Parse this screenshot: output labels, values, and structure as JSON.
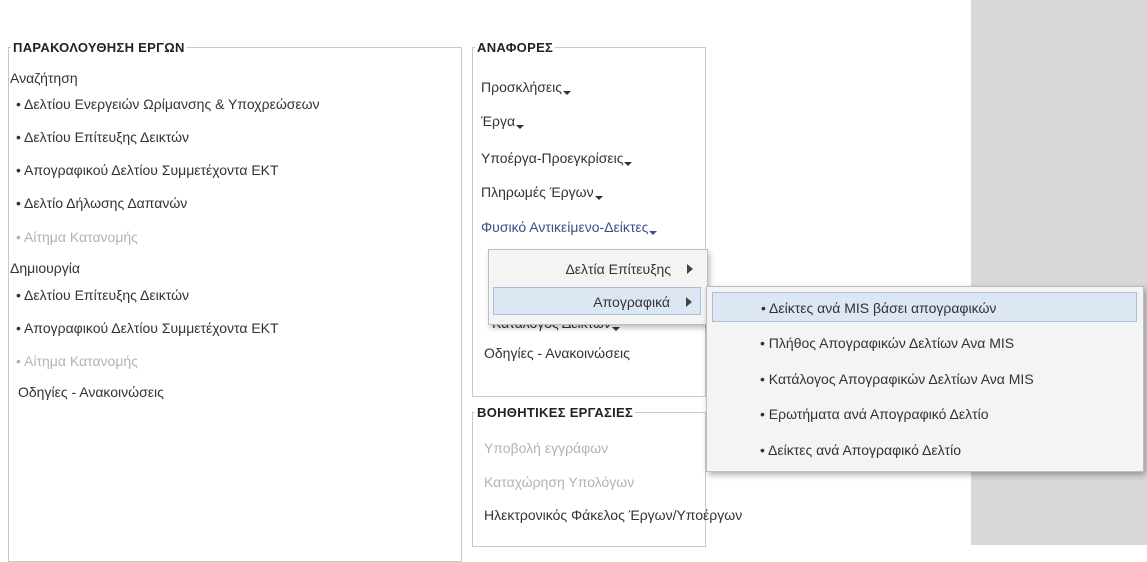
{
  "projects": {
    "legend": "ΠΑΡΑΚΟΛΟΥΘΗΣΗ ΕΡΓΩΝ",
    "search_heading": "Αναζήτηση",
    "search_items": [
      "Δελτίου Ενεργειών Ωρίμανσης & Υποχρεώσεων",
      "Δελτίου Επίτευξης Δεικτών",
      "Απογραφικού Δελτίου Συμμετέχοντα ΕΚΤ",
      "Δελτίο Δήλωσης Δαπανών",
      "Αίτημα Κατανομής"
    ],
    "create_heading": "Δημιουργία",
    "create_items": [
      "Δελτίου Επίτευξης Δεικτών",
      "Απογραφικού Δελτίου Συμμετέχοντα ΕΚΤ",
      "Αίτημα Κατανομής"
    ],
    "instructions": "Οδηγίες - Ανακοινώσεις"
  },
  "reports": {
    "legend": "ΑΝΑΦΟΡΕΣ",
    "items": [
      "Προσκλήσεις",
      "Έργα",
      "Υποέργα-Προεγκρίσεις",
      "Πληρωμές Έργων",
      "Φυσικό Αντικείμενο-Δείκτες"
    ],
    "hidden_item": "Κατάλογος Δεικτών",
    "instructions": "Οδηγίες - Ανακοινώσεις"
  },
  "aux": {
    "legend": "ΒΟΗΘΗΤΙΚΕΣ ΕΡΓΑΣΙΕΣ",
    "items": [
      "Υποβολή εγγράφων",
      "Καταχώρηση Υπολόγων",
      "Ηλεκτρονικός Φάκελος Έργων/Υποέργων"
    ]
  },
  "submenu1": {
    "items": [
      "Δελτία Επίτευξης",
      "Απογραφικά"
    ]
  },
  "submenu2": {
    "items": [
      "Δείκτες ανά MIS βάσει απογραφικών",
      "Πλήθος Απογραφικών Δελτίων Ανα MIS",
      "Κατάλογος Απογραφικών Δελτίων Ανα MIS",
      "Ερωτήματα ανά Απογραφικό Δελτίο",
      "Δείκτες ανά Απογραφικό Δελτίο"
    ]
  }
}
